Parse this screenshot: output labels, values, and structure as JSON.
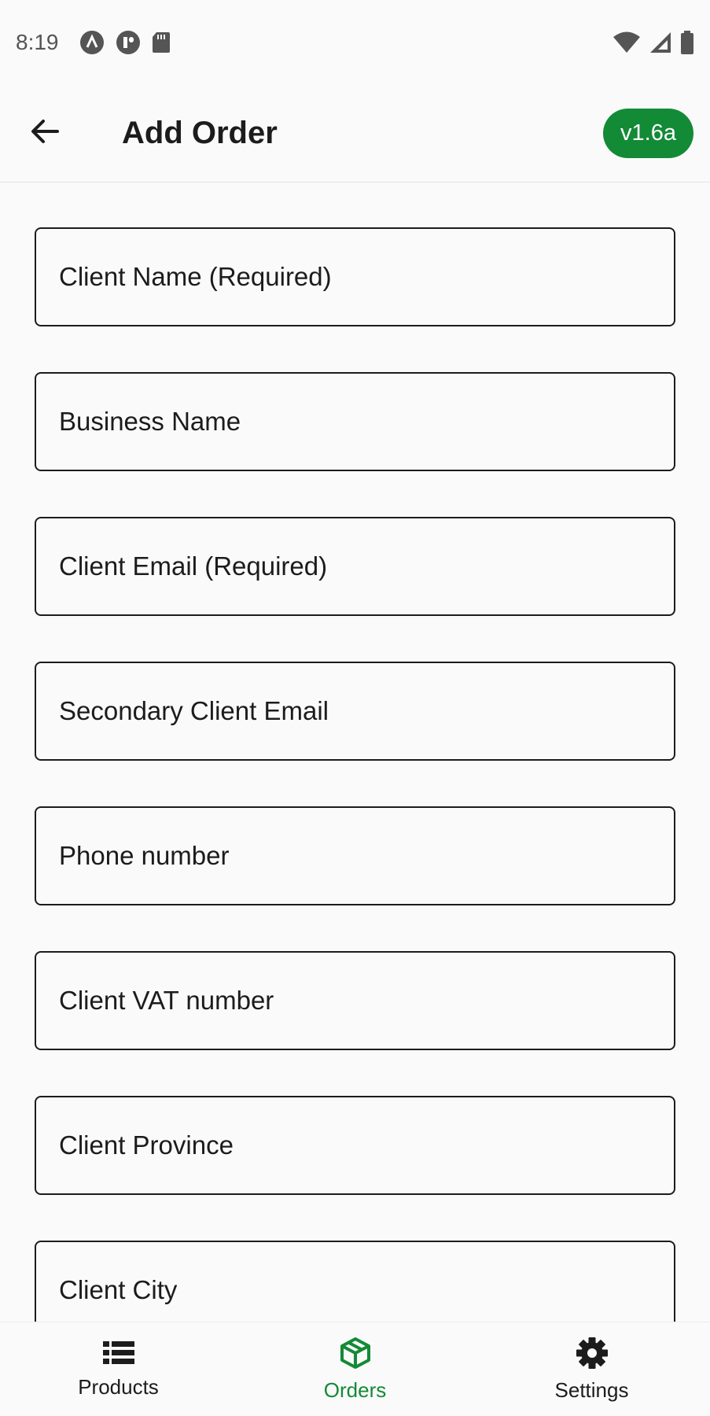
{
  "status_bar": {
    "time": "8:19",
    "left_icons": [
      "a11y-icon",
      "app-notification-icon",
      "sd-card-icon"
    ],
    "right_icons": [
      "wifi-icon",
      "signal-icon",
      "battery-icon"
    ]
  },
  "app_bar": {
    "back_icon": "arrow-back-icon",
    "title": "Add Order",
    "version_badge": "v1.6a",
    "badge_color": "#138a36"
  },
  "form": {
    "fields": [
      {
        "placeholder": "Client Name (Required)",
        "value": ""
      },
      {
        "placeholder": "Business Name",
        "value": ""
      },
      {
        "placeholder": "Client Email (Required)",
        "value": ""
      },
      {
        "placeholder": "Secondary Client Email",
        "value": ""
      },
      {
        "placeholder": "Phone number",
        "value": ""
      },
      {
        "placeholder": "Client VAT number",
        "value": ""
      },
      {
        "placeholder": "Client Province",
        "value": ""
      },
      {
        "placeholder": "Client City",
        "value": ""
      }
    ]
  },
  "bottom_nav": {
    "items": [
      {
        "label": "Products",
        "icon": "list-icon",
        "active": false
      },
      {
        "label": "Orders",
        "icon": "package-icon",
        "active": true
      },
      {
        "label": "Settings",
        "icon": "gear-icon",
        "active": false
      }
    ],
    "active_color": "#138a36"
  }
}
